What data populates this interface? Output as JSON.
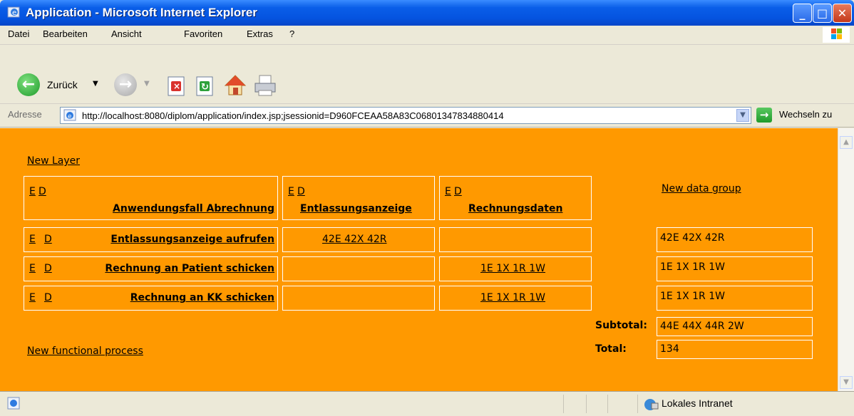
{
  "window": {
    "title": "Application - Microsoft Internet Explorer"
  },
  "menu": [
    "Datei",
    "Bearbeiten",
    "Ansicht",
    "Favoriten",
    "Extras",
    "?"
  ],
  "toolbar": {
    "back_label": "Zurück"
  },
  "address": {
    "label": "Adresse",
    "url": "http://localhost:8080/diplom/application/index.jsp;jsessionid=D960FCEAA58A83C06801347834880414",
    "go_label": "Wechseln zu"
  },
  "page": {
    "new_layer": "New Layer",
    "new_data_group": "New data group",
    "new_functional_process": "New functional process",
    "edit_label": "E",
    "delete_label": "D",
    "header": {
      "application": "Anwendungsfall Abrechnung",
      "data_groups": [
        "Entlassungsanzeige",
        "Rechnungsdaten"
      ]
    },
    "rows": [
      {
        "name": "Entlassungsanzeige aufrufen",
        "cells": [
          "42E 42X 42R",
          ""
        ],
        "sum": "42E 42X 42R"
      },
      {
        "name": "Rechnung an Patient schicken",
        "cells": [
          "",
          "1E 1X 1R 1W"
        ],
        "sum": "1E 1X 1R 1W"
      },
      {
        "name": "Rechnung an KK schicken",
        "cells": [
          "",
          "1E 1X 1R 1W"
        ],
        "sum": "1E 1X 1R 1W"
      }
    ],
    "subtotal_label": "Subtotal:",
    "subtotal_value": "44E 44X 44R 2W",
    "total_label": "Total:",
    "total_value": "134"
  },
  "status": {
    "zone": "Lokales Intranet"
  },
  "colors": {
    "content_bg": "#ff9900",
    "titlebar": "#0554e0"
  }
}
